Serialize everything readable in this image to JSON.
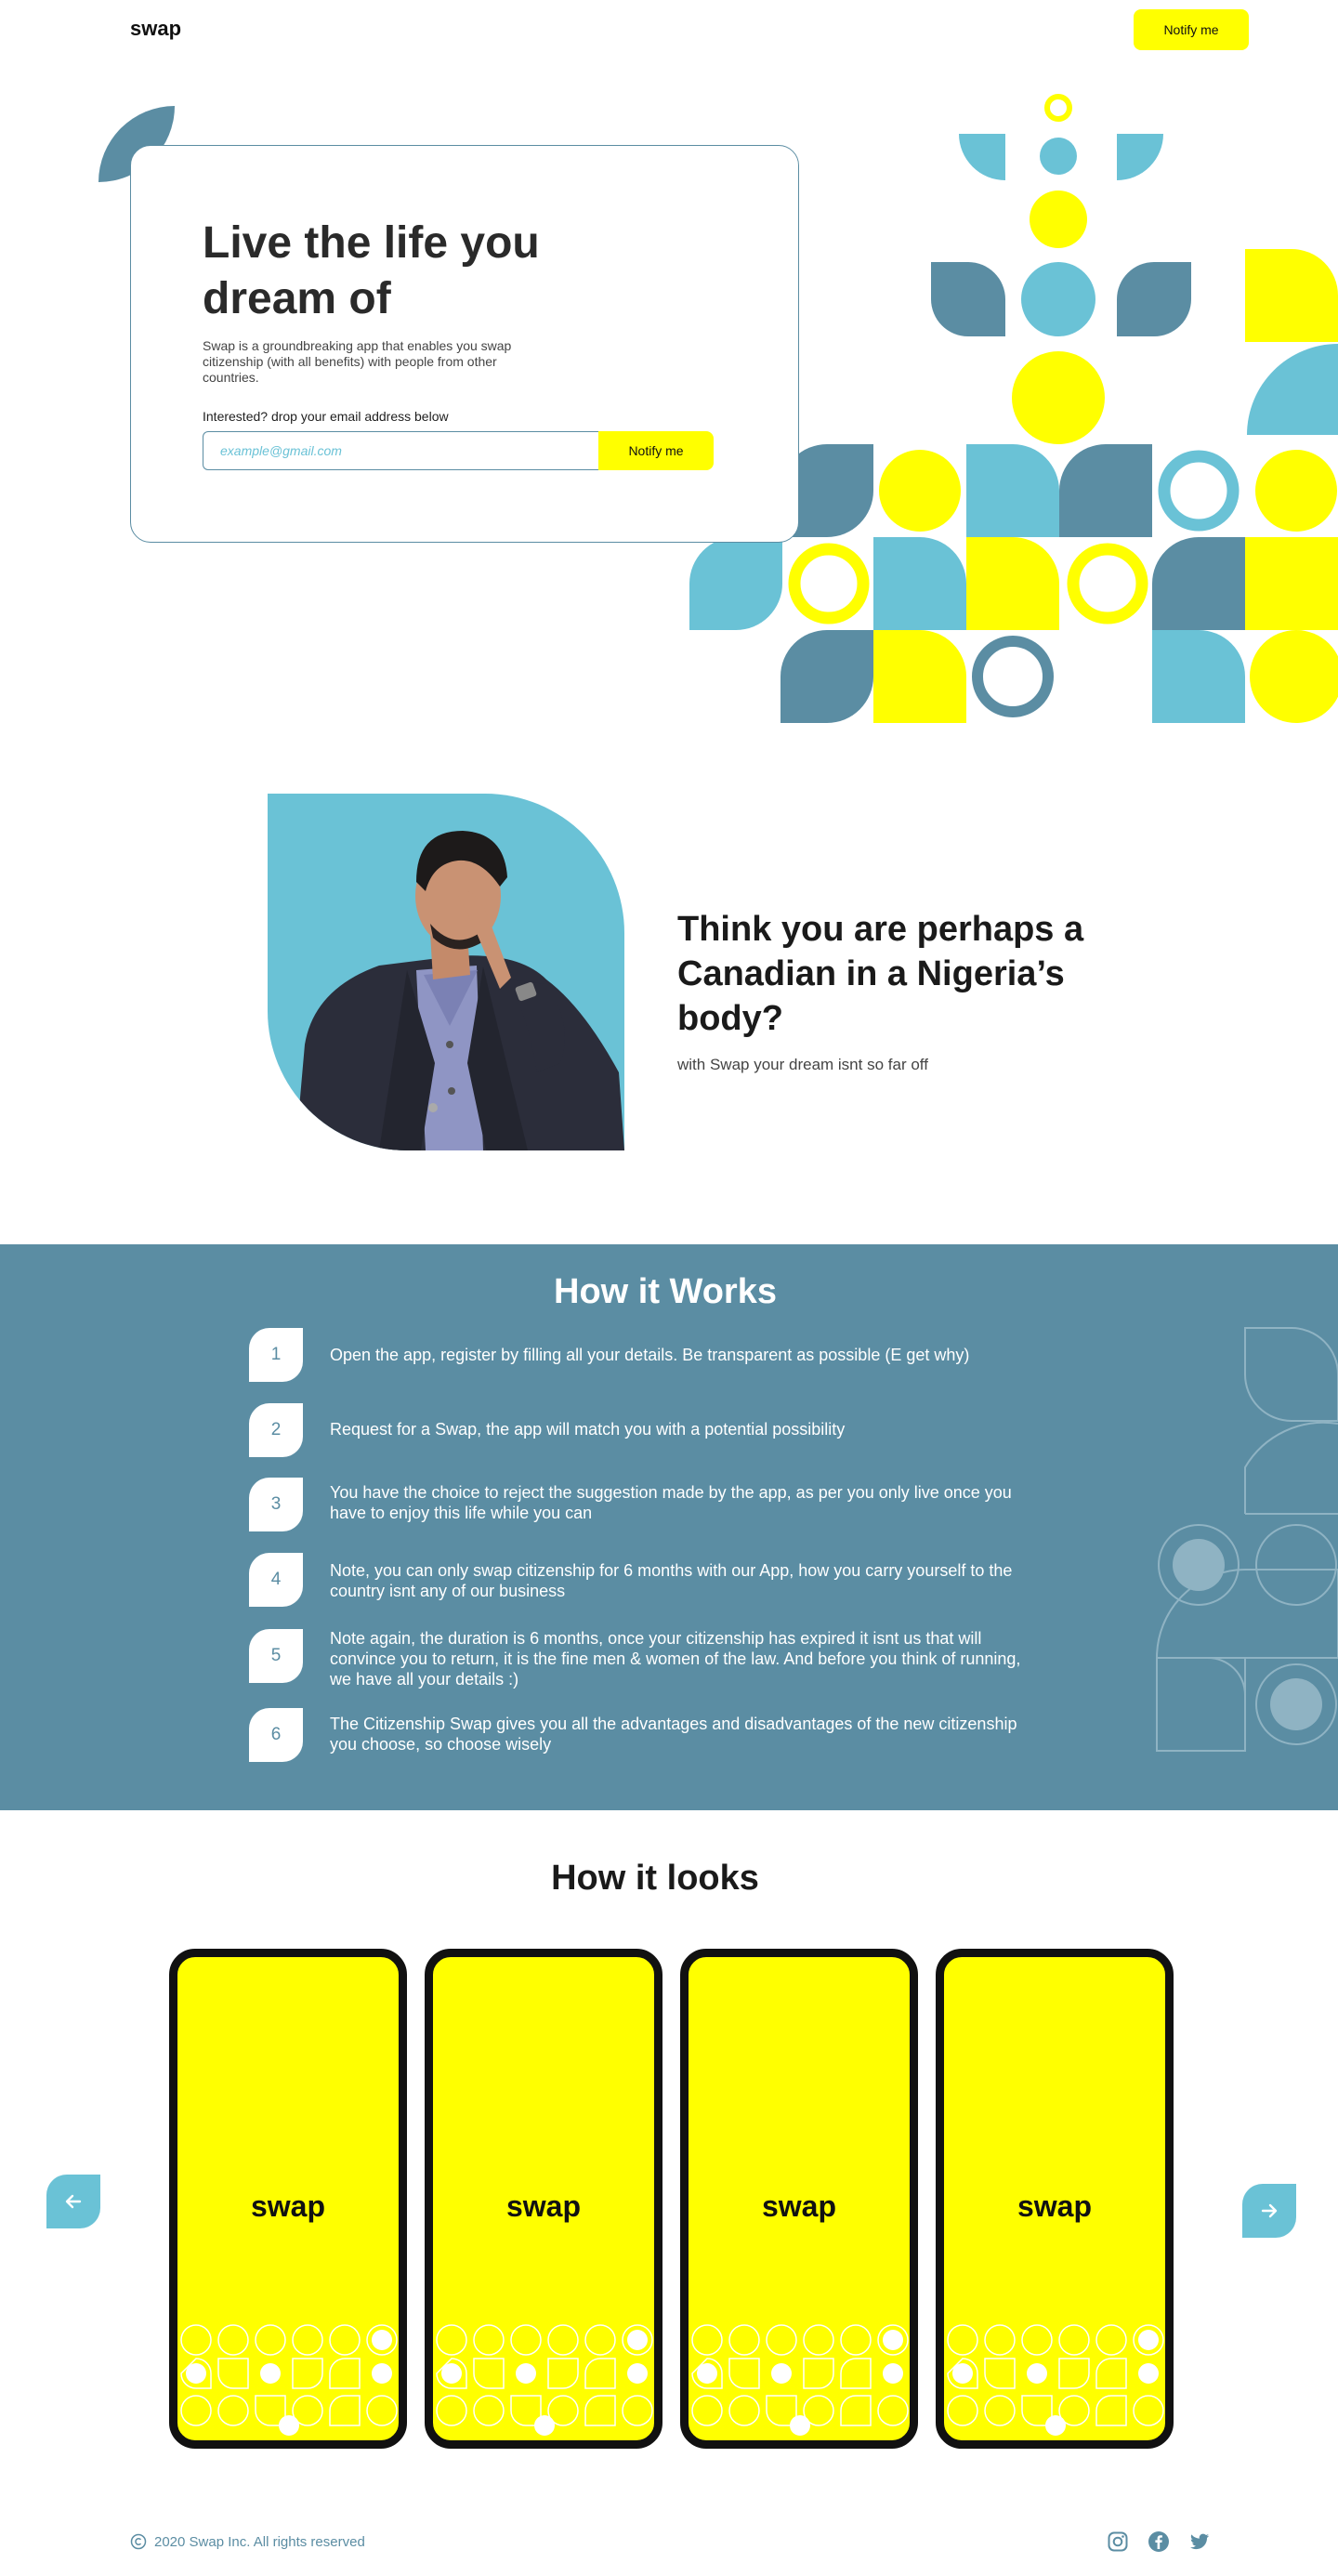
{
  "header": {
    "logo": "swap",
    "notify_label": "Notify me"
  },
  "hero": {
    "title": "Live the life you dream of",
    "description": "Swap is a groundbreaking app that enables you swap citizenship (with all benefits) with people from other countries.",
    "email_label": "Interested? drop your email address below",
    "email_placeholder": "example@gmail.com",
    "notify_label": "Notify me"
  },
  "feature": {
    "title": "Think you are perhaps a Canadian in a Nigeria’s body?",
    "subtitle": "with Swap your dream isnt so far off"
  },
  "how_it_works": {
    "title": "How it Works",
    "steps": [
      {
        "num": "1",
        "text": "Open the app, register by filling all your details. Be transparent as possible (E get why)"
      },
      {
        "num": "2",
        "text": "Request for a Swap, the app will match you with a potential possibility"
      },
      {
        "num": "3",
        "text": "You have the choice to reject the suggestion made by the app, as per you only live once you have to enjoy this life while you can"
      },
      {
        "num": "4",
        "text": "Note, you can only swap citizenship for 6 months with our App, how you carry yourself to the country isnt any of our business"
      },
      {
        "num": "5",
        "text": "Note again, the duration is 6 months, once your citizenship has expired it isnt us that will convince you to return, it is the fine men & women of the law. And before you think of running, we have all your details :)"
      },
      {
        "num": "6",
        "text": "The Citizenship Swap gives you all the advantages and disadvantages of the new citizenship you choose, so choose wisely"
      }
    ]
  },
  "how_it_looks": {
    "title": "How it looks",
    "phones": [
      {
        "logo": "swap"
      },
      {
        "logo": "swap"
      },
      {
        "logo": "swap"
      },
      {
        "logo": "swap"
      }
    ],
    "prev_icon": "arrow-left-icon",
    "next_icon": "arrow-right-icon"
  },
  "footer": {
    "copyright": "2020 Swap Inc. All rights reserved",
    "socials": [
      "instagram-icon",
      "facebook-icon",
      "twitter-icon"
    ]
  },
  "colors": {
    "yellow": "#ffff00",
    "teal": "#5b8da3",
    "sky": "#6ac2d6",
    "dark": "#1a1a1a"
  }
}
